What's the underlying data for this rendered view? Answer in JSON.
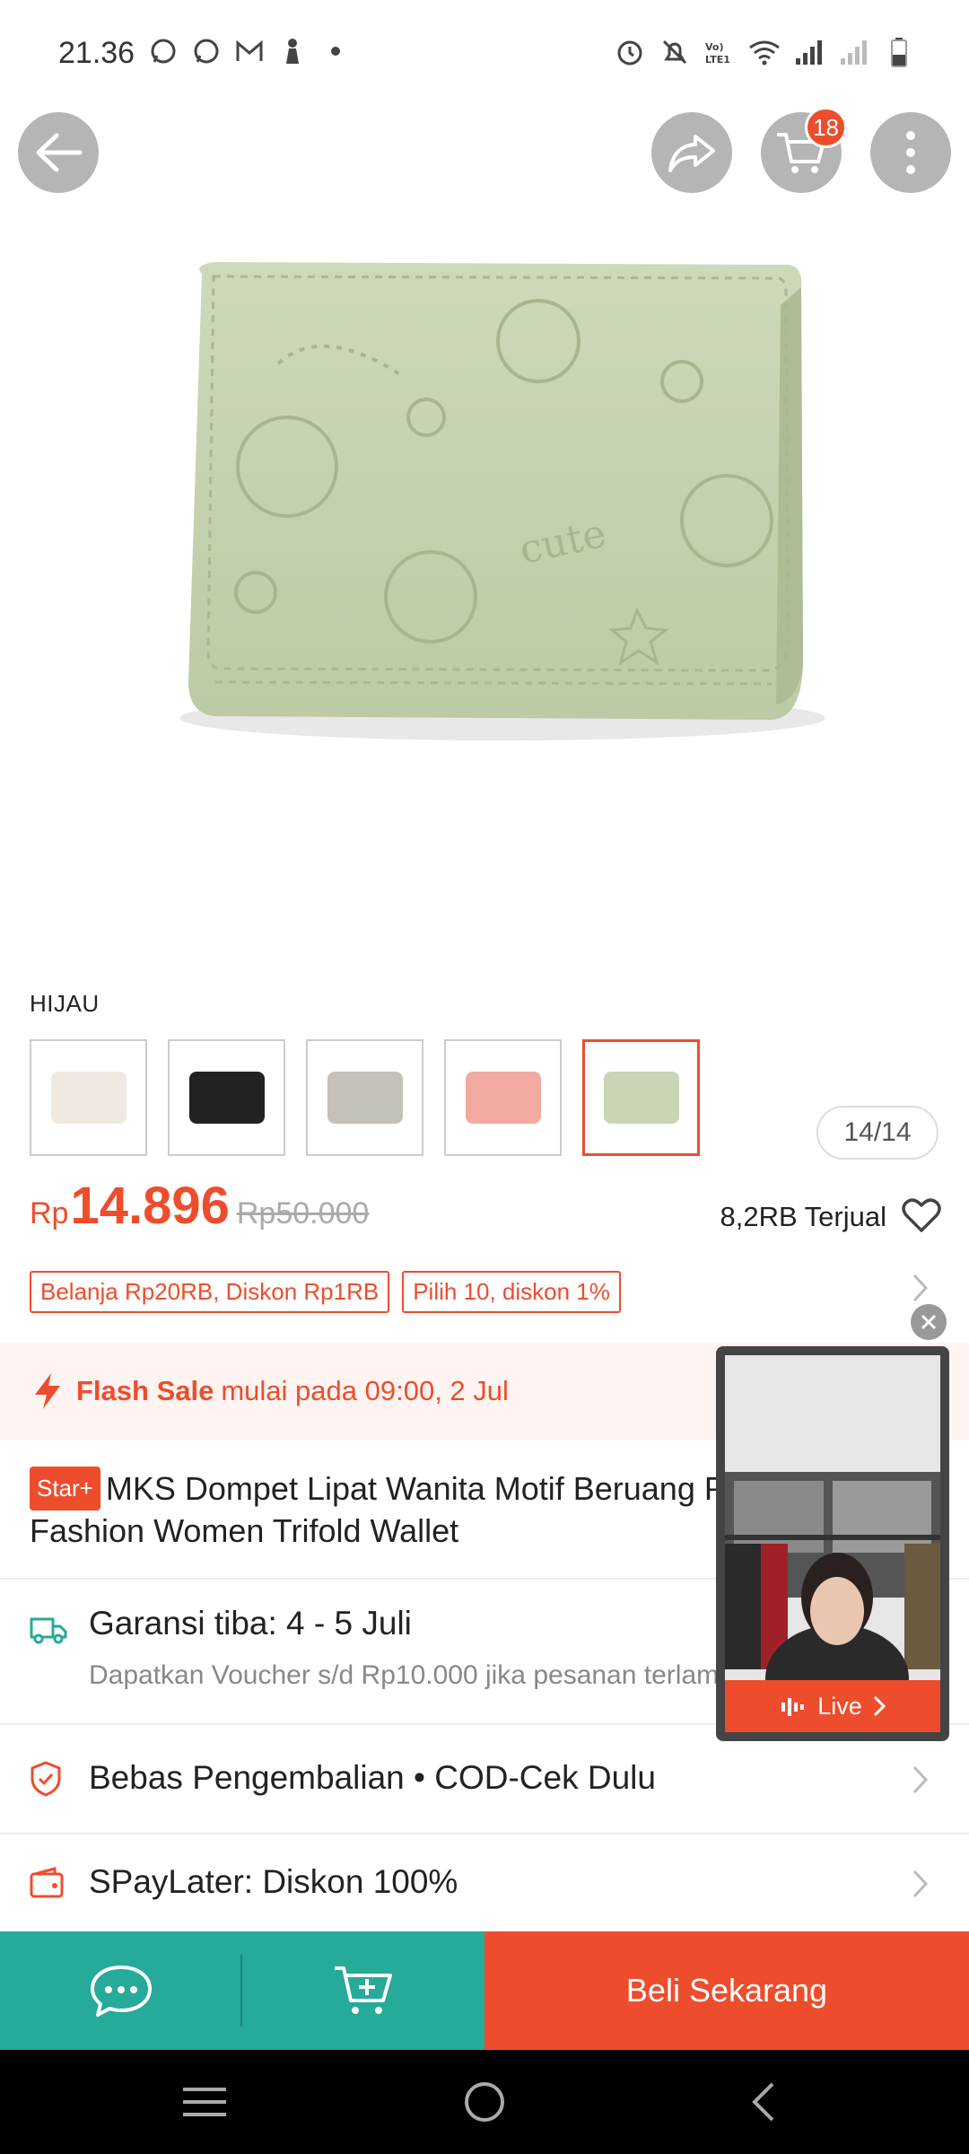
{
  "status_bar": {
    "time": "21.36",
    "left_icons": [
      "whatsapp-icon",
      "whatsapp-business-icon",
      "gmail-icon",
      "notification-icon",
      "dot-icon"
    ],
    "right_icons": [
      "alarm-icon",
      "mute-icon",
      "volte-icon",
      "wifi-icon",
      "signal-icon",
      "signal-weak-icon",
      "battery-icon"
    ]
  },
  "top_bar": {
    "cart_count": "18"
  },
  "gallery": {
    "counter": "14/14",
    "image_colors": {
      "wallet": "#c9d5b4",
      "wallet_shadow": "#aebc96"
    }
  },
  "variation": {
    "selected_label": "HIJAU",
    "options": [
      {
        "color": "#efe9df"
      },
      {
        "color": "#222222"
      },
      {
        "color": "#c4c0ba"
      },
      {
        "color": "#f2aaa0"
      },
      {
        "color": "#c9d5b4",
        "selected": true
      }
    ]
  },
  "price": {
    "currency": "Rp",
    "value": "14.896",
    "original": "Rp50.000",
    "sold": "8,2RB Terjual"
  },
  "vouchers": [
    "Belanja Rp20RB, Diskon Rp1RB",
    "Pilih 10, diskon 1%"
  ],
  "flash_sale": {
    "title": "Flash Sale",
    "text": "mulai pada 09:00, 2 Jul"
  },
  "product": {
    "badge": "Star+",
    "title": "MKS Dompet Lipat Wanita Motif Beruang Pendek Wanita Fashion Women Trifold Wallet"
  },
  "shipping": {
    "title": "Garansi tiba: 4 - 5 Juli",
    "subtitle": "Dapatkan Voucher s/d Rp10.000 jika pesanan terlambat."
  },
  "returns": {
    "text": "Bebas Pengembalian  •  COD-Cek Dulu"
  },
  "paylater": {
    "text": "SPayLater: Diskon 100%"
  },
  "live": {
    "label": "Live"
  },
  "bottom_bar": {
    "buy_label": "Beli Sekarang"
  },
  "colors": {
    "accent": "#ee4d2d",
    "teal": "#26aa99"
  }
}
